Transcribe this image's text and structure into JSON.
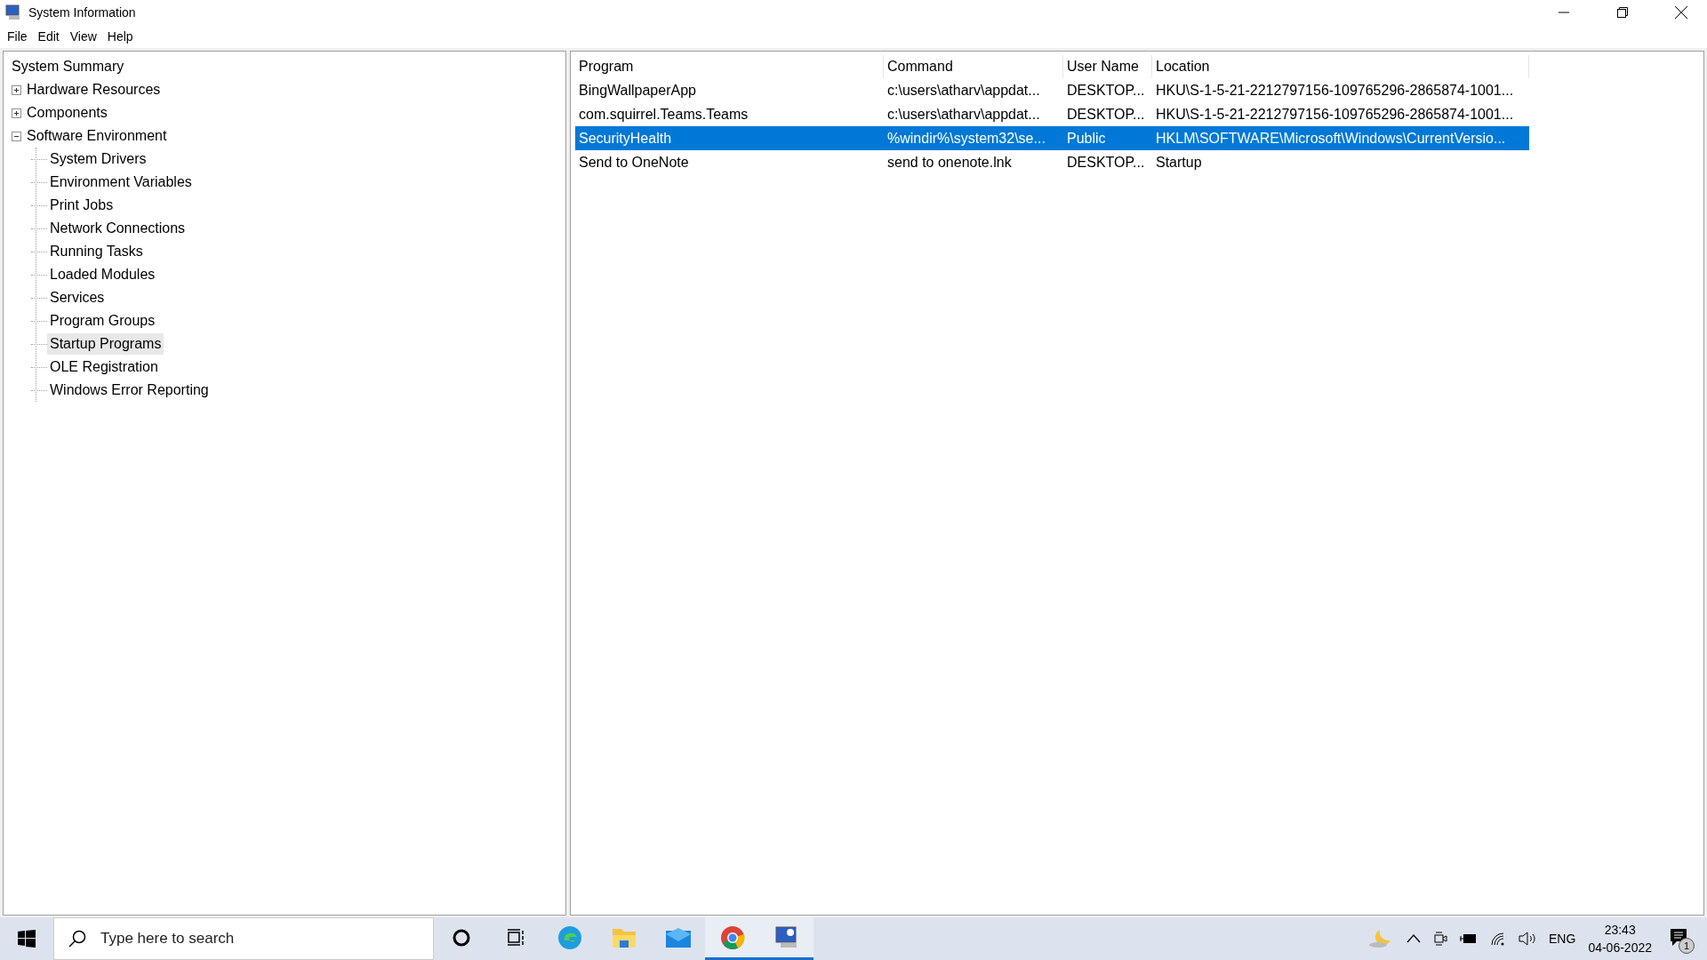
{
  "window": {
    "title": "System Information"
  },
  "menu": [
    "File",
    "Edit",
    "View",
    "Help"
  ],
  "tree": [
    {
      "label": "System Summary",
      "selected": false,
      "children": [
        {
          "label": "Hardware Resources",
          "selected": false,
          "expanded": false
        },
        {
          "label": "Components",
          "selected": false,
          "expanded": false
        },
        {
          "label": "Software Environment",
          "selected": false,
          "expanded": true,
          "children": [
            {
              "label": "System Drivers",
              "selected": false
            },
            {
              "label": "Environment Variables",
              "selected": false
            },
            {
              "label": "Print Jobs",
              "selected": false
            },
            {
              "label": "Network Connections",
              "selected": false
            },
            {
              "label": "Running Tasks",
              "selected": false
            },
            {
              "label": "Loaded Modules",
              "selected": false
            },
            {
              "label": "Services",
              "selected": false
            },
            {
              "label": "Program Groups",
              "selected": false
            },
            {
              "label": "Startup Programs",
              "selected": true
            },
            {
              "label": "OLE Registration",
              "selected": false
            },
            {
              "label": "Windows Error Reporting",
              "selected": false
            }
          ]
        }
      ]
    }
  ],
  "table": {
    "columns": [
      "Program",
      "Command",
      "User Name",
      "Location"
    ],
    "rows": [
      {
        "cells": [
          "BingWallpaperApp",
          "c:\\users\\atharv\\appdat...",
          "DESKTOP...",
          "HKU\\S-1-5-21-2212797156-109765296-2865874-1001..."
        ],
        "selected": false
      },
      {
        "cells": [
          "com.squirrel.Teams.Teams",
          "c:\\users\\atharv\\appdat...",
          "DESKTOP...",
          "HKU\\S-1-5-21-2212797156-109765296-2865874-1001..."
        ],
        "selected": false
      },
      {
        "cells": [
          "SecurityHealth",
          "%windir%\\system32\\se...",
          "Public",
          "HKLM\\SOFTWARE\\Microsoft\\Windows\\CurrentVersio..."
        ],
        "selected": true
      },
      {
        "cells": [
          "Send to OneNote",
          "send to onenote.lnk",
          "DESKTOP...",
          "Startup"
        ],
        "selected": false
      }
    ]
  },
  "taskbar": {
    "search": {
      "placeholder": "Type here to search"
    },
    "apps": [
      {
        "kind": "cortana",
        "active": false
      },
      {
        "kind": "taskview",
        "active": false
      },
      {
        "kind": "edge",
        "active": false
      },
      {
        "kind": "explorer",
        "active": false
      },
      {
        "kind": "mail",
        "active": false
      },
      {
        "kind": "chrome",
        "active": true
      },
      {
        "kind": "sysinfo",
        "active": true
      }
    ],
    "language": "ENG",
    "time": "23:43",
    "date": "04-06-2022",
    "notifications": "1"
  }
}
